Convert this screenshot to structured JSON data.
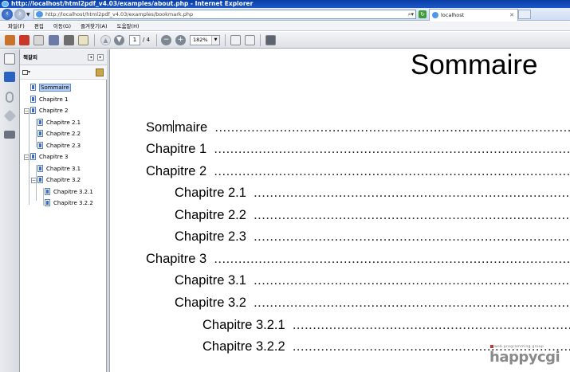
{
  "window": {
    "title": "http://localhost/html2pdf_v4.03/examples/about.php - Internet Explorer"
  },
  "browser": {
    "url": "http://localhost/html2pdf_v4.03/examples/bookmark.php",
    "tab_label": "localhost",
    "menu": [
      "파일(F)",
      "편집",
      "이동(G)",
      "즐겨찾기(A)",
      "도움말(H)"
    ]
  },
  "pdf_toolbar": {
    "page_current": "1",
    "page_total": "/ 4",
    "zoom": "182%"
  },
  "bookmarks_panel": {
    "title": "책갈피",
    "items": [
      {
        "label": "Sommaire",
        "level": 0,
        "selected": true
      },
      {
        "label": "Chapitre 1",
        "level": 0
      },
      {
        "label": "Chapitre 2",
        "level": 0,
        "expanded": true
      },
      {
        "label": "Chapitre 2.1",
        "level": 1
      },
      {
        "label": "Chapitre 2.2",
        "level": 1
      },
      {
        "label": "Chapitre 2.3",
        "level": 1
      },
      {
        "label": "Chapitre 3",
        "level": 0,
        "expanded": true
      },
      {
        "label": "Chapitre 3.1",
        "level": 1
      },
      {
        "label": "Chapitre 3.2",
        "level": 1,
        "expanded": true
      },
      {
        "label": "Chapitre 3.2.1",
        "level": 2
      },
      {
        "label": "Chapitre 3.2.2",
        "level": 2
      }
    ]
  },
  "document": {
    "title": "Sommaire",
    "toc": [
      {
        "pre": "Som",
        "post": "maire",
        "dots": ".........................................................................................",
        "level": 0
      },
      {
        "label": "Chapitre 1",
        "dots": ".........................................................................................",
        "level": 0
      },
      {
        "label": "Chapitre 2",
        "dots": ".........................................................................................",
        "level": 0
      },
      {
        "label": "Chapitre 2.1",
        "dots": ".........................................................................................",
        "level": 1
      },
      {
        "label": "Chapitre 2.2",
        "dots": ".........................................................................................",
        "level": 1
      },
      {
        "label": "Chapitre 2.3",
        "dots": ".........................................................................................",
        "level": 1
      },
      {
        "label": "Chapitre 3",
        "dots": ".........................................................................................",
        "level": 0
      },
      {
        "label": "Chapitre 3.1",
        "dots": ".........................................................................................",
        "level": 1
      },
      {
        "label": "Chapitre 3.2",
        "dots": ".........................................................................................",
        "level": 1
      },
      {
        "label": "Chapitre 3.2.1",
        "dots": ".........................................................................................",
        "level": 2
      },
      {
        "label": "Chapitre 3.2.2",
        "dots": ".........................................................................................",
        "level": 2
      }
    ]
  },
  "watermark": {
    "small": "web programming group",
    "big": "happycgi"
  }
}
